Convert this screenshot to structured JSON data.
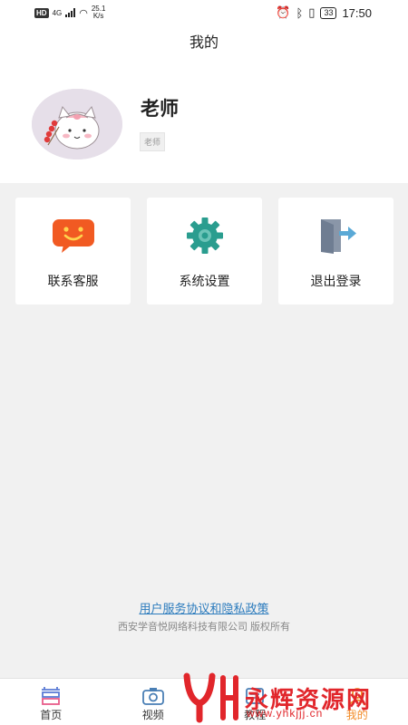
{
  "status_bar": {
    "badge": "HD",
    "network": "4G",
    "speed_value": "25.1",
    "speed_unit": "K/s",
    "battery": "33",
    "time": "17:50"
  },
  "header": {
    "title": "我的"
  },
  "profile": {
    "name": "老师",
    "role_tag": "老师"
  },
  "cards": [
    {
      "label": "联系客服",
      "icon": "customer-service-icon",
      "color": "#f15a22"
    },
    {
      "label": "系统设置",
      "icon": "gear-icon",
      "color": "#2a9d8f"
    },
    {
      "label": "退出登录",
      "icon": "logout-icon",
      "color": "#5aa9d6"
    }
  ],
  "footer": {
    "agreement_link": "用户服务协议和隐私政策",
    "copyright": "西安学音悦网络科技有限公司 版权所有"
  },
  "tabs": [
    {
      "label": "首页",
      "icon": "home-icon"
    },
    {
      "label": "视频",
      "icon": "camera-icon"
    },
    {
      "label": "教程",
      "icon": "tutorial-icon"
    },
    {
      "label": "我的",
      "icon": "user-icon",
      "active": true
    }
  ],
  "watermark": {
    "text": "永辉资源网",
    "url": "www.yhkjjj.cn"
  },
  "colors": {
    "accent": "#f28c28",
    "link": "#2b7bbd",
    "watermark": "#e1262b"
  }
}
